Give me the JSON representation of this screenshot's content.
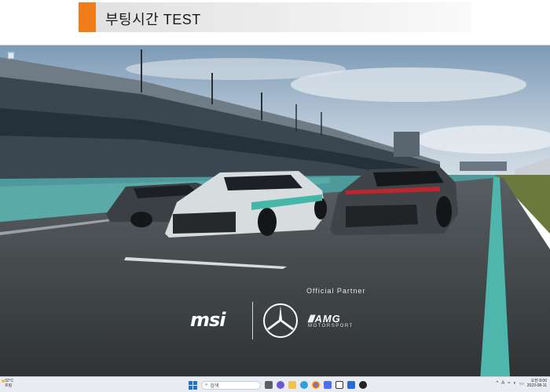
{
  "header": {
    "title": "부팅시간 TEST"
  },
  "wallpaper": {
    "partner_label": "Official Partner",
    "brand_msi": "msi",
    "brand_amg": "AMG",
    "brand_amg_sub": "MOTORSPORT"
  },
  "taskbar": {
    "weather_temp": "32°C",
    "weather_desc": "흐림",
    "search_placeholder": "검색",
    "clock_time": "오전 8:00",
    "clock_date": "2023-08-11",
    "tray_lang": "A"
  },
  "colors": {
    "accent": "#f27b1a",
    "windows_blue": "#1f74d6"
  }
}
